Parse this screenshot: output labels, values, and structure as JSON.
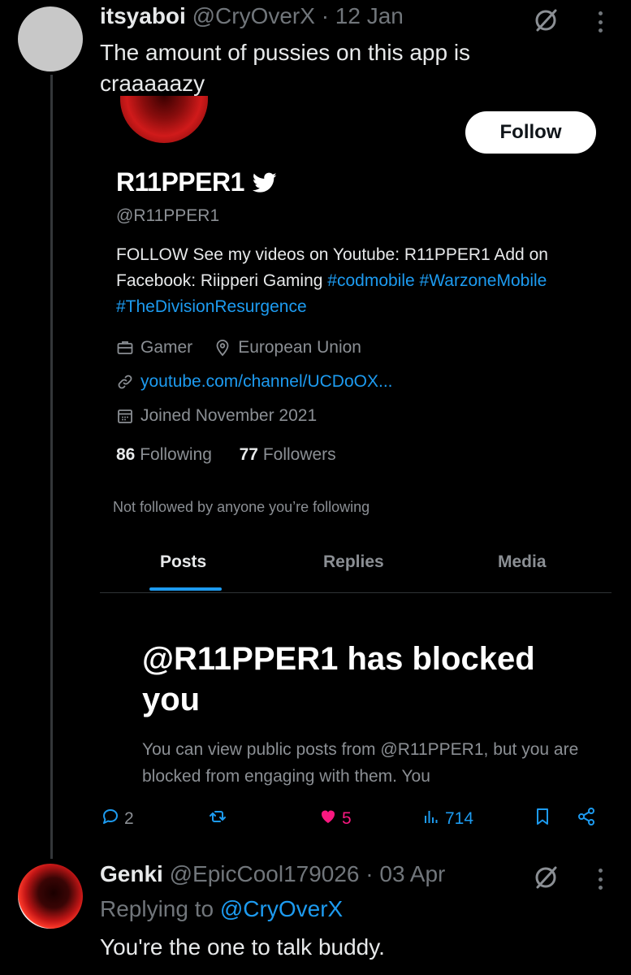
{
  "tweet": {
    "author_name": "itsyaboi",
    "author_handle": "@CryOverX",
    "date": "· 12 Jan",
    "text": "The amount of pussies on this app is craaaaazy"
  },
  "profile_card": {
    "follow_label": "Follow",
    "name": "R11PPER1",
    "handle": "@R11PPER1",
    "bio_text": "FOLLOW  See my videos on Youtube: R11PPER1 Add on Facebook: Riipperi Gaming ",
    "bio_hashtag_1": "#codmobile",
    "bio_hashtag_2": "#WarzoneMobile",
    "bio_hashtag_3": "#TheDivisionResurgence",
    "occupation": "Gamer",
    "location": "European Union",
    "website": "youtube.com/channel/UCDoOX...",
    "joined": "Joined November 2021",
    "following_count": "86",
    "following_label": "Following",
    "followers_count": "77",
    "followers_label": "Followers",
    "not_followed": "Not followed by anyone you’re following",
    "tabs": [
      {
        "label": "Posts"
      },
      {
        "label": "Replies"
      },
      {
        "label": "Media"
      }
    ],
    "blocked_title": "@R11PPER1 has blocked you",
    "blocked_desc": "You can view public posts from @R11PPER1, but you are blocked from engaging with them. You"
  },
  "actions": {
    "replies": "2",
    "likes": "5",
    "views": "714"
  },
  "reply": {
    "author_name": "Genki",
    "author_handle": "@EpicCool179026",
    "date": "· 03 Apr",
    "replying_prefix": "Replying to ",
    "replying_handle": "@CryOverX",
    "text": "You're the one to talk buddy."
  },
  "colors": {
    "accent": "#1d9bf0",
    "like": "#f91880",
    "background": "#000000"
  }
}
